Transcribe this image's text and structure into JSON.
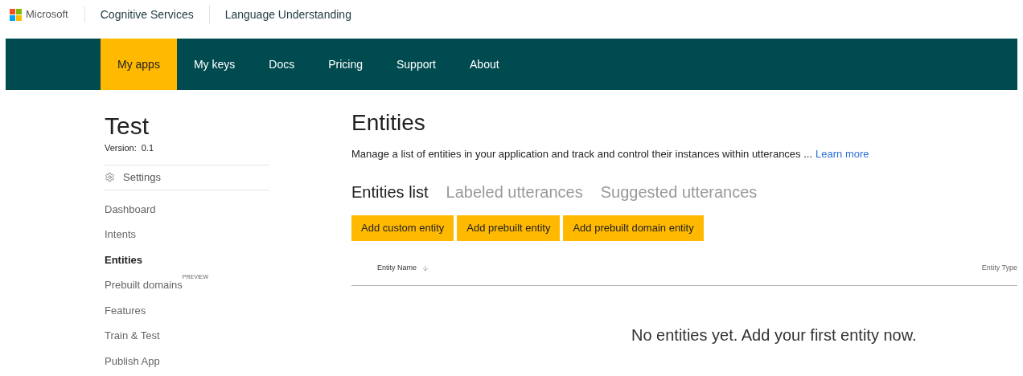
{
  "top_bar": {
    "brand": "Microsoft",
    "links": [
      "Cognitive Services",
      "Language Understanding"
    ]
  },
  "nav": [
    {
      "label": "My apps",
      "selected": true
    },
    {
      "label": "My keys",
      "selected": false
    },
    {
      "label": "Docs",
      "selected": false
    },
    {
      "label": "Pricing",
      "selected": false
    },
    {
      "label": "Support",
      "selected": false
    },
    {
      "label": "About",
      "selected": false
    }
  ],
  "sidebar": {
    "app_name": "Test",
    "version_label": "Version:",
    "version": "0.1",
    "settings": "Settings",
    "items": [
      {
        "label": "Dashboard",
        "selected": false
      },
      {
        "label": "Intents",
        "selected": false
      },
      {
        "label": "Entities",
        "selected": true
      },
      {
        "label": "Prebuilt domains",
        "badge": "PREVIEW",
        "selected": false
      },
      {
        "label": "Features",
        "selected": false
      },
      {
        "label": "Train & Test",
        "selected": false
      },
      {
        "label": "Publish App",
        "selected": false
      }
    ]
  },
  "main": {
    "title": "Entities",
    "description": "Manage a list of entities in your application and track and control their instances within utterances ...",
    "learn_more": "Learn more",
    "tabs": [
      {
        "label": "Entities list",
        "selected": true
      },
      {
        "label": "Labeled utterances",
        "selected": false
      },
      {
        "label": "Suggested utterances",
        "selected": false
      }
    ],
    "buttons": [
      "Add custom entity",
      "Add prebuilt entity",
      "Add prebuilt domain entity"
    ],
    "table": {
      "columns": [
        "Entity Name",
        "Entity Type"
      ],
      "empty_message": "No entities yet. Add your first entity now."
    }
  }
}
